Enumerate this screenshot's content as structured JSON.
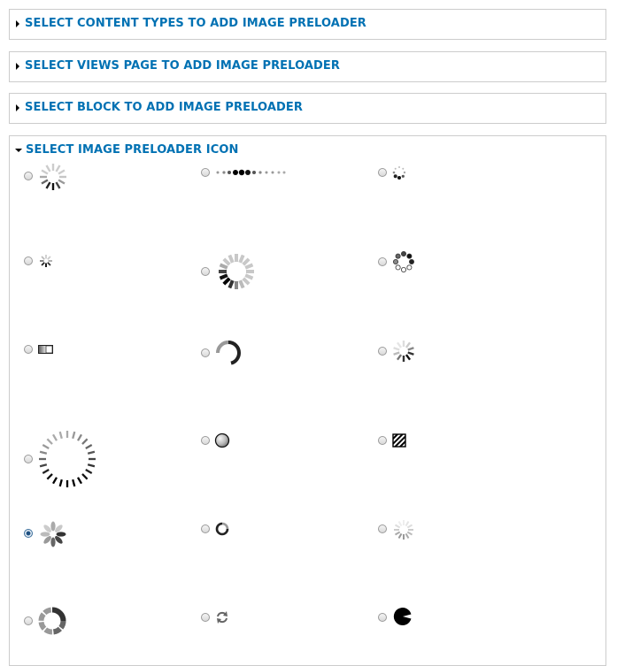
{
  "sections": [
    {
      "title": "SELECT CONTENT TYPES TO ADD IMAGE PRELOADER",
      "expanded": false
    },
    {
      "title": "SELECT VIEWS PAGE TO ADD IMAGE PRELOADER",
      "expanded": false
    },
    {
      "title": "SELECT BLOCK TO ADD IMAGE PRELOADER",
      "expanded": false
    },
    {
      "title": "SELECT IMAGE PRELOADER ICON",
      "expanded": true
    }
  ],
  "icons": {
    "selected": "flower-spinner",
    "items": [
      "spokes-spinner",
      "dots-bar-spinner",
      "dots-circle-small-spinner",
      "tiny-spokes-spinner",
      "bars-ring-spinner",
      "circles-ring-spinner",
      "progress-bar-spinner",
      "arc-spinner",
      "fading-spokes-spinner",
      "large-dashes-spinner",
      "gradient-ball-spinner",
      "striped-box-spinner",
      "flower-spinner",
      "circle-arc-spinner",
      "light-spokes-spinner",
      "segment-ring-spinner",
      "refresh-arrows-spinner",
      "pacman-spinner"
    ]
  },
  "colors": {
    "accent": "#0071b3",
    "border": "#cccccc"
  }
}
